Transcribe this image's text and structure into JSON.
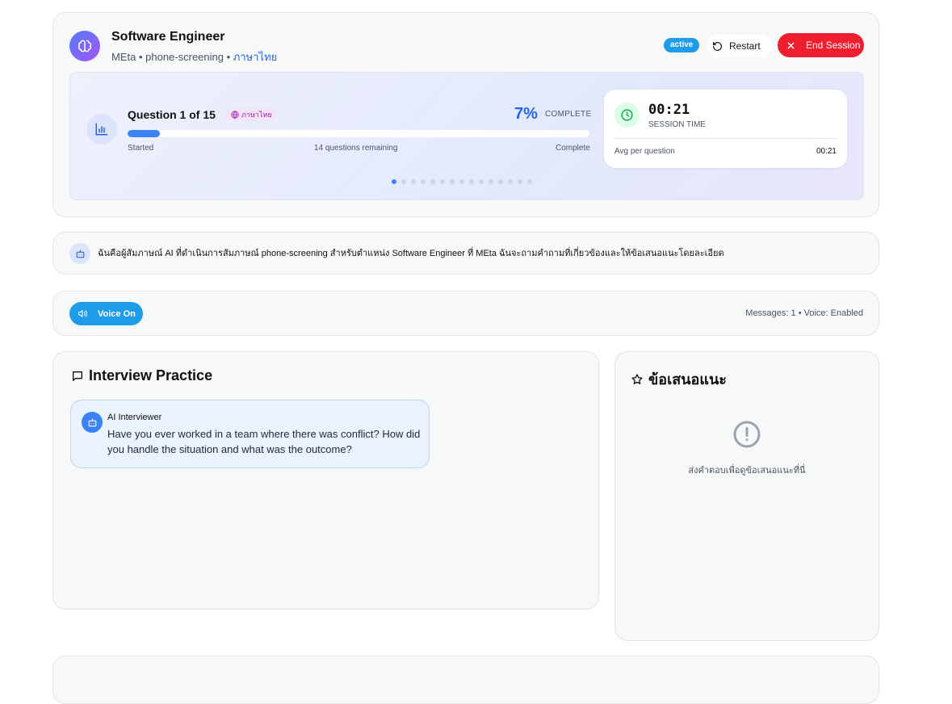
{
  "header": {
    "job_title": "Software Engineer",
    "company": "MEta",
    "interview_type": "phone-screening",
    "language": "ภาษาไทย",
    "status_badge": "active",
    "restart_label": "Restart",
    "end_session_label": "End Session"
  },
  "progress": {
    "question_label": "Question 1 of 15",
    "language_pill": "ภาษาไทย",
    "percent_text": "7%",
    "percent_value": 7,
    "complete_label": "COMPLETE",
    "start_label": "Started",
    "remaining_label": "14 questions remaining",
    "end_label": "Complete",
    "total_questions": 15,
    "current_question": 1
  },
  "timer": {
    "value": "00:21",
    "label": "SESSION TIME",
    "avg_label": "Avg per question",
    "avg_value": "00:21"
  },
  "intro": {
    "text": "ฉันคือผู้สัมภาษณ์ AI ที่ดำเนินการสัมภาษณ์ phone-screening สำหรับตำแหน่ง Software Engineer ที่ MEta ฉันจะถามคำถามที่เกี่ยวข้องและให้ข้อเสนอแนะโดยละเอียด"
  },
  "voice": {
    "button_label": "Voice On",
    "status_text": "Messages: 1 • Voice: Enabled"
  },
  "chat": {
    "title": "Interview Practice",
    "messages": [
      {
        "sender": "AI Interviewer",
        "text": "Have you ever worked in a team where there was conflict? How did you handle the situation and what was the outcome?"
      }
    ]
  },
  "suggestions": {
    "title": "ข้อเสนอแนะ",
    "empty_text": "ส่งคำตอบเพื่อดูข้อเสนอแนะที่นี่"
  },
  "colors": {
    "accent": "#3b82f6",
    "badge": "#1e9be9",
    "danger": "#ef1f2f",
    "timer_icon_bg": "#dcfce7"
  }
}
